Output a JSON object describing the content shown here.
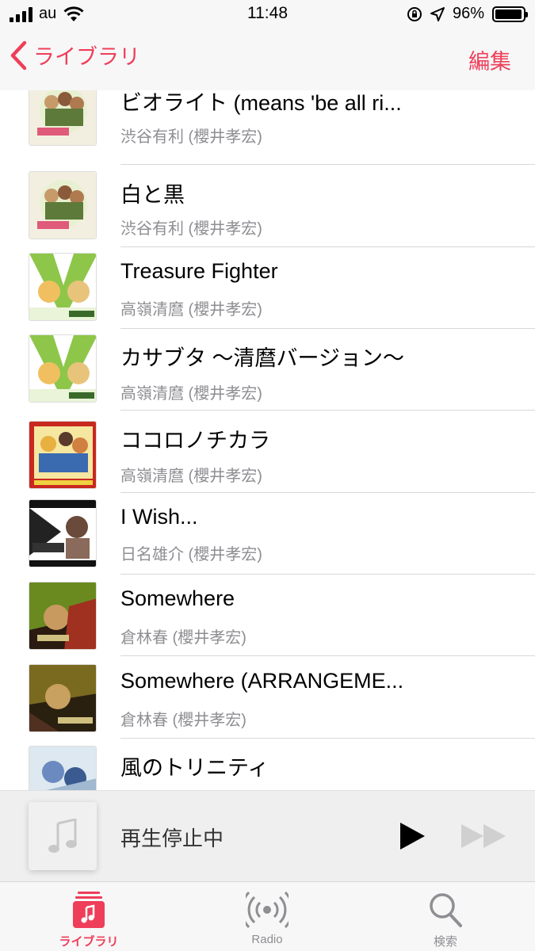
{
  "status_bar": {
    "carrier": "au",
    "time": "11:48",
    "battery": "96%",
    "battery_level": 0.96,
    "icons": [
      "signal-icon",
      "wifi-icon",
      "rotation-lock-icon",
      "location-icon",
      "battery-icon"
    ]
  },
  "nav": {
    "back_label": "ライブラリ",
    "edit_label": "編集"
  },
  "songs": [
    {
      "title": "ビオライト (means 'be all ri...",
      "artist": "渋谷有利 (櫻井孝宏)"
    },
    {
      "title": "白と黒",
      "artist": "渋谷有利 (櫻井孝宏)"
    },
    {
      "title": "Treasure Fighter",
      "artist": "高嶺清麿 (櫻井孝宏)"
    },
    {
      "title": "カサブタ ～清麿バージョン～",
      "artist": "高嶺清麿 (櫻井孝宏)"
    },
    {
      "title": "ココロノチカラ",
      "artist": "高嶺清麿 (櫻井孝宏)"
    },
    {
      "title": "I Wish...",
      "artist": "日名雄介 (櫻井孝宏)"
    },
    {
      "title": "Somewhere",
      "artist": "倉林春 (櫻井孝宏)"
    },
    {
      "title": "Somewhere (ARRANGEME...",
      "artist": "倉林春 (櫻井孝宏)"
    },
    {
      "title": "風のトリニティ",
      "artist": ""
    }
  ],
  "mini_player": {
    "status": "再生停止中",
    "icons": [
      "music-note-icon",
      "play-icon",
      "fast-forward-icon"
    ]
  },
  "tabs": [
    {
      "label": "ライブラリ",
      "icon": "library-icon",
      "active": true
    },
    {
      "label": "Radio",
      "icon": "radio-icon",
      "active": false
    },
    {
      "label": "検索",
      "icon": "search-icon",
      "active": false
    }
  ],
  "colors": {
    "accent": "#ee3e5a",
    "secondary_text": "#8e8e93",
    "divider": "#d8d8d8"
  }
}
